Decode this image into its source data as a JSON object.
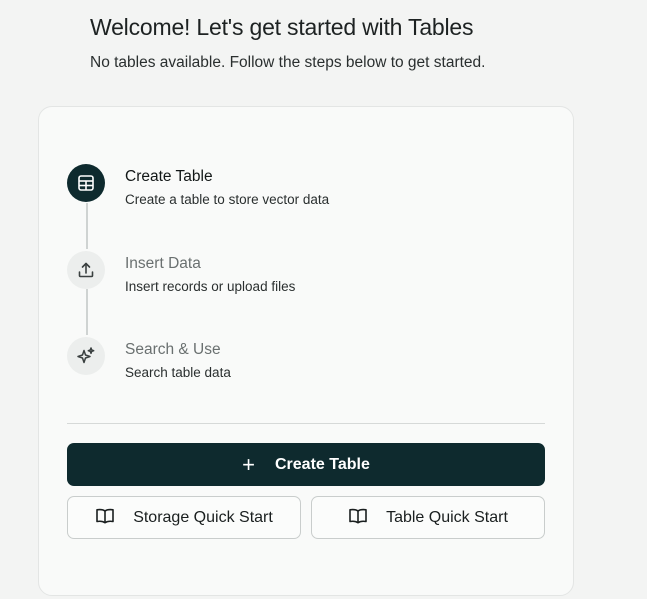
{
  "header": {
    "title": "Welcome! Let's get started with Tables",
    "subtitle": "No tables available. Follow the steps below to get started."
  },
  "steps": [
    {
      "icon": "table-grid-icon",
      "title": "Create Table",
      "description": "Create a table to store vector data",
      "state": "active"
    },
    {
      "icon": "upload-icon",
      "title": "Insert Data",
      "description": "Insert records or upload files",
      "state": "inactive"
    },
    {
      "icon": "sparkles-icon",
      "title": "Search & Use",
      "description": "Search table data",
      "state": "inactive"
    }
  ],
  "actions": {
    "create_table": {
      "icon": "plus-icon",
      "label": "Create Table"
    },
    "storage_quick_start": {
      "icon": "book-open-icon",
      "label": "Storage Quick Start"
    },
    "table_quick_start": {
      "icon": "book-open-icon",
      "label": "Table Quick Start"
    }
  },
  "colors": {
    "primary": "#0e2a2e",
    "background": "#f3f4f3",
    "card": "#f9faf9"
  }
}
